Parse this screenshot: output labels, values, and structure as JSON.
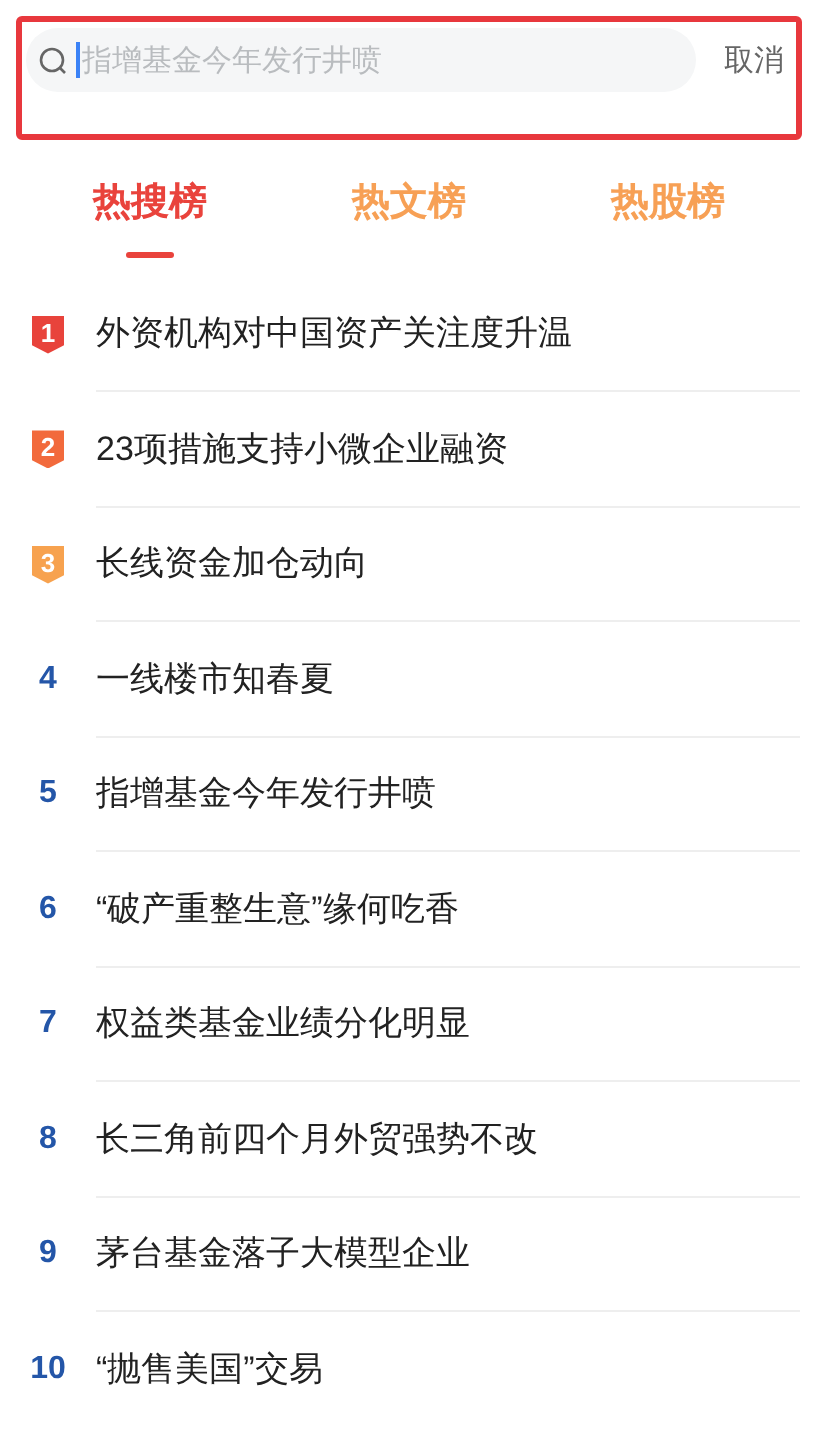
{
  "search": {
    "placeholder": "指增基金今年发行井喷",
    "cancel": "取消"
  },
  "tabs": [
    {
      "label": "热搜榜",
      "selected": true
    },
    {
      "label": "热文榜",
      "selected": false
    },
    {
      "label": "热股榜",
      "selected": false
    }
  ],
  "items": [
    {
      "rank": "1",
      "title": "外资机构对中国资产关注度升温",
      "kind": "badge",
      "color": "#e8433b"
    },
    {
      "rank": "2",
      "title": "23项措施支持小微企业融资",
      "kind": "badge",
      "color": "#f26a3c"
    },
    {
      "rank": "3",
      "title": "长线资金加仓动向",
      "kind": "badge",
      "color": "#f7a24f"
    },
    {
      "rank": "4",
      "title": "一线楼市知春夏",
      "kind": "number"
    },
    {
      "rank": "5",
      "title": "指增基金今年发行井喷",
      "kind": "number"
    },
    {
      "rank": "6",
      "title": "“破产重整生意”缘何吃香",
      "kind": "number"
    },
    {
      "rank": "7",
      "title": "权益类基金业绩分化明显",
      "kind": "number"
    },
    {
      "rank": "8",
      "title": "长三角前四个月外贸强势不改",
      "kind": "number"
    },
    {
      "rank": "9",
      "title": "茅台基金落子大模型企业",
      "kind": "number"
    },
    {
      "rank": "10",
      "title": "“抛售美国”交易",
      "kind": "number"
    }
  ]
}
